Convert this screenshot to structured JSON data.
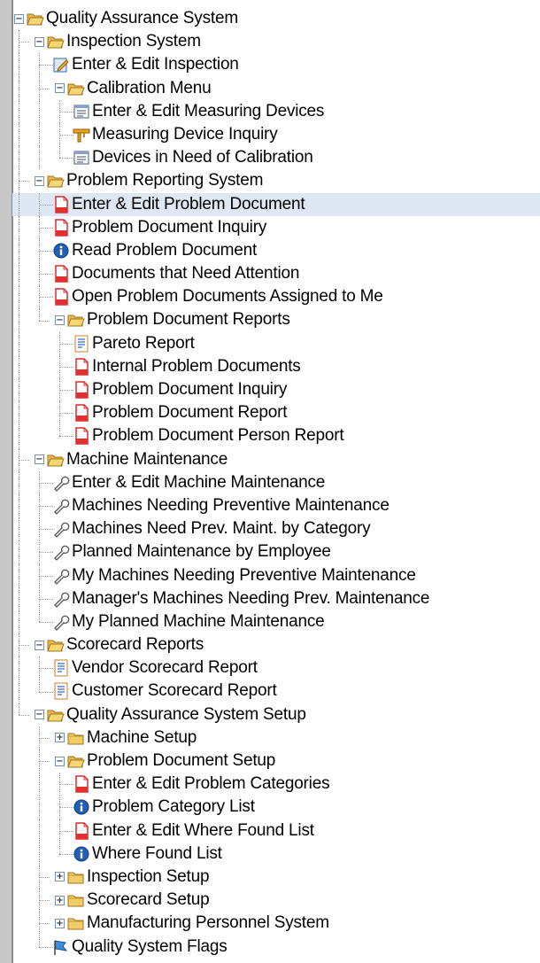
{
  "tree": [
    {
      "d": 0,
      "label": "Quality Assurance System",
      "icon": "folder-open-icon",
      "exp": "minus"
    },
    {
      "d": 1,
      "label": "Inspection System",
      "icon": "folder-open-icon",
      "exp": "minus"
    },
    {
      "d": 2,
      "label": "Enter & Edit Inspection",
      "icon": "edit-form-icon"
    },
    {
      "d": 2,
      "label": "Calibration Menu",
      "icon": "folder-open-icon",
      "exp": "minus"
    },
    {
      "d": 3,
      "label": "Enter & Edit Measuring Devices",
      "icon": "list-form-icon"
    },
    {
      "d": 3,
      "label": "Measuring Device Inquiry",
      "icon": "caliper-icon"
    },
    {
      "d": 3,
      "label": "Devices in Need of Calibration",
      "icon": "list-form-icon",
      "last": true
    },
    {
      "d": 1,
      "label": "Problem Reporting System",
      "icon": "folder-open-icon",
      "exp": "minus"
    },
    {
      "d": 2,
      "label": "Enter & Edit Problem Document",
      "icon": "red-document-icon",
      "selected": true
    },
    {
      "d": 2,
      "label": "Problem Document Inquiry",
      "icon": "red-document-icon"
    },
    {
      "d": 2,
      "label": "Read Problem Document",
      "icon": "info-icon"
    },
    {
      "d": 2,
      "label": "Documents that Need Attention",
      "icon": "red-document-icon"
    },
    {
      "d": 2,
      "label": "Open Problem Documents Assigned to Me",
      "icon": "red-document-icon"
    },
    {
      "d": 2,
      "label": "Problem Document Reports",
      "icon": "folder-open-icon",
      "exp": "minus",
      "last": true
    },
    {
      "d": 3,
      "label": "Pareto Report",
      "icon": "report-icon"
    },
    {
      "d": 3,
      "label": "Internal Problem Documents",
      "icon": "red-document-icon"
    },
    {
      "d": 3,
      "label": "Problem Document Inquiry",
      "icon": "red-document-icon"
    },
    {
      "d": 3,
      "label": "Problem Document Report",
      "icon": "red-document-icon"
    },
    {
      "d": 3,
      "label": "Problem Document Person Report",
      "icon": "red-document-icon",
      "last": true
    },
    {
      "d": 1,
      "label": "Machine Maintenance",
      "icon": "folder-open-icon",
      "exp": "minus"
    },
    {
      "d": 2,
      "label": "Enter & Edit Machine Maintenance",
      "icon": "wrench-icon"
    },
    {
      "d": 2,
      "label": "Machines Needing Preventive Maintenance",
      "icon": "wrench-icon"
    },
    {
      "d": 2,
      "label": "Machines Need Prev. Maint. by Category",
      "icon": "wrench-icon"
    },
    {
      "d": 2,
      "label": "Planned Maintenance by Employee",
      "icon": "wrench-icon"
    },
    {
      "d": 2,
      "label": "My Machines Needing Preventive Maintenance",
      "icon": "wrench-icon"
    },
    {
      "d": 2,
      "label": "Manager's Machines Needing Prev. Maintenance",
      "icon": "wrench-icon"
    },
    {
      "d": 2,
      "label": "My Planned Machine Maintenance",
      "icon": "wrench-icon",
      "last": true
    },
    {
      "d": 1,
      "label": "Scorecard Reports",
      "icon": "folder-open-icon",
      "exp": "minus"
    },
    {
      "d": 2,
      "label": "Vendor Scorecard Report",
      "icon": "report-icon"
    },
    {
      "d": 2,
      "label": "Customer Scorecard Report",
      "icon": "report-icon",
      "last": true
    },
    {
      "d": 1,
      "label": "Quality Assurance System Setup",
      "icon": "folder-open-icon",
      "exp": "minus",
      "last": true
    },
    {
      "d": 2,
      "label": "Machine Setup",
      "icon": "folder-closed-icon",
      "exp": "plus"
    },
    {
      "d": 2,
      "label": "Problem Document Setup",
      "icon": "folder-open-icon",
      "exp": "minus"
    },
    {
      "d": 3,
      "label": "Enter & Edit Problem Categories",
      "icon": "red-document-icon"
    },
    {
      "d": 3,
      "label": "Problem Category List",
      "icon": "info-icon"
    },
    {
      "d": 3,
      "label": "Enter & Edit Where Found List",
      "icon": "red-document-icon"
    },
    {
      "d": 3,
      "label": "Where Found List",
      "icon": "info-icon",
      "last": true
    },
    {
      "d": 2,
      "label": "Inspection Setup",
      "icon": "folder-closed-icon",
      "exp": "plus"
    },
    {
      "d": 2,
      "label": "Scorecard Setup",
      "icon": "folder-closed-icon",
      "exp": "plus"
    },
    {
      "d": 2,
      "label": "Manufacturing Personnel System",
      "icon": "folder-closed-icon",
      "exp": "plus"
    },
    {
      "d": 2,
      "label": "Quality System Flags",
      "icon": "flags-icon",
      "last": true
    }
  ],
  "colors": {
    "selected": "#dde8f4",
    "folder": "#f2c75a",
    "folder_dark": "#c9962c",
    "doc_red": "#d92b2b",
    "info_blue": "#1f5fb5"
  }
}
